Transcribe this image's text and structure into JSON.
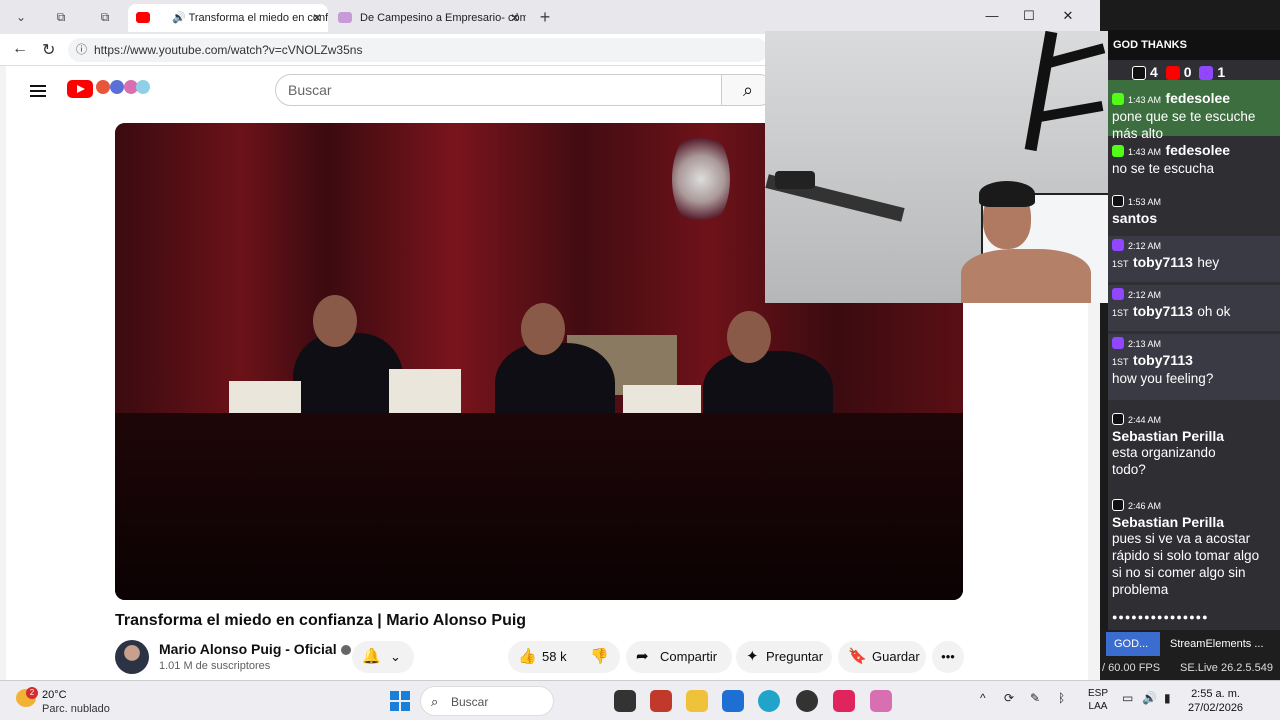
{
  "browser": {
    "tabs": [
      {
        "title": "Transforma el miedo en confianza",
        "active": true
      },
      {
        "title": "De Campesino a Empresario- cóm",
        "active": false
      }
    ],
    "new_tab_label": "+",
    "url": "https://www.youtube.com/watch?v=cVNOLZw35ns"
  },
  "youtube": {
    "search_placeholder": "Buscar",
    "video_title": "Transforma el miedo en confianza | Mario Alonso Puig",
    "channel_name": "Mario Alonso Puig - Oficial",
    "subscribers": "1.01 M de suscriptores",
    "likes": "58 k",
    "share_label": "Compartir",
    "ask_label": "Preguntar",
    "save_label": "Guardar",
    "more_label": "•••"
  },
  "chat": {
    "header": "GOD THANKS",
    "counts": {
      "tiktok": "4",
      "youtube": "0",
      "twitch": "1"
    },
    "messages": [
      {
        "platform": "kick",
        "time": "1:43 AM",
        "user": "fedesolee",
        "text": "pone que se te escuche más alto",
        "highlight": true
      },
      {
        "platform": "kick",
        "time": "1:43 AM",
        "user": "fedesolee",
        "text": "no se te escucha",
        "highlight": false
      },
      {
        "platform": "tiktok",
        "time": "1:53 AM",
        "user": "santos",
        "text": "",
        "highlight": false
      },
      {
        "platform": "twitch",
        "time": "2:12 AM",
        "user": "toby7113",
        "text": "hey",
        "highlight": true
      },
      {
        "platform": "twitch",
        "time": "2:12 AM",
        "user": "toby7113",
        "text": "oh ok",
        "highlight": true
      },
      {
        "platform": "twitch",
        "time": "2:13 AM",
        "user": "toby7113",
        "text": "how you feeling?",
        "highlight": true
      },
      {
        "platform": "tiktok",
        "time": "2:44 AM",
        "user": "Sebastian Perilla",
        "text": "esta organizando todo?",
        "highlight": false
      },
      {
        "platform": "tiktok",
        "time": "2:46 AM",
        "user": "Sebastian Perilla",
        "text": "pues si ve va a acostar rápido si solo tomar algo si no si comer algo sin problema",
        "highlight": false
      }
    ],
    "sub_badge": "1ST"
  },
  "dock": {
    "tab_god": "GOD...",
    "tab_streamelements": "StreamElements ...",
    "fps": "/ 60.00 FPS",
    "version": "SE.Live 26.2.5.549"
  },
  "taskbar": {
    "weather_badge": "2",
    "temperature": "20°C",
    "condition": "Parc. nublado",
    "search_placeholder": "Buscar",
    "lang_top": "ESP",
    "lang_bottom": "LAA",
    "time": "2:55 a. m.",
    "date": "27/02/2026"
  },
  "colors": {
    "youtube_red": "#ff0000",
    "twitch_purple": "#9146ff",
    "kick_green": "#53fc18",
    "chat_highlight": "#3d6e3f"
  }
}
